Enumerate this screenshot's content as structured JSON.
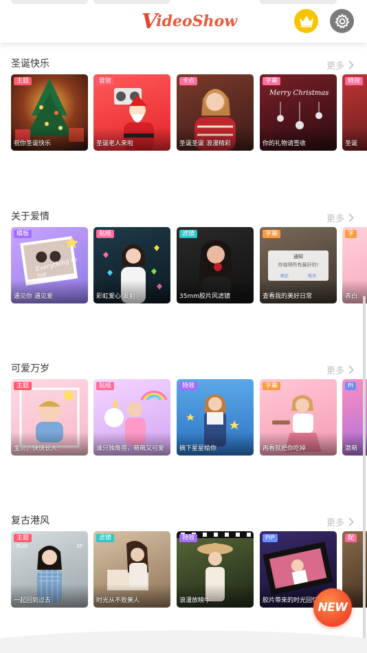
{
  "header": {
    "logo_text": "VideoShow",
    "logo_first": "V",
    "logo_rest": "ideoShow",
    "vip_icon": "crown-icon",
    "settings_icon": "gear-icon"
  },
  "more_label": "更多",
  "sections": [
    {
      "title": "圣诞快乐",
      "cards": [
        {
          "tag": "主题",
          "caption": "祝你圣诞快乐"
        },
        {
          "tag": "音效",
          "caption": "圣诞老人来啦"
        },
        {
          "tag": "卡点",
          "caption": "圣诞圣诞 浪漫精彩"
        },
        {
          "tag": "字幕",
          "caption": "你的礼物请签收"
        },
        {
          "tag": "特效",
          "caption": "圣诞"
        }
      ]
    },
    {
      "title": "关于爱情",
      "cards": [
        {
          "tag": "模板",
          "caption": "遇见你 遇见爱"
        },
        {
          "tag": "贴纸",
          "caption": "彩虹爱心 发射"
        },
        {
          "tag": "滤镜",
          "caption": "35mm胶片风滤镜"
        },
        {
          "tag": "字幕",
          "caption": "查看我的美好日常"
        },
        {
          "tag": "字",
          "caption": "表白"
        }
      ]
    },
    {
      "title": "可爱万岁",
      "cards": [
        {
          "tag": "主题",
          "caption": "宝贝，快快长大"
        },
        {
          "tag": "贴纸",
          "caption": "谁只独角兽，萌萌又可爱"
        },
        {
          "tag": "特效",
          "caption": "摘下星星给你"
        },
        {
          "tag": "字幕",
          "caption": "再看就把你吃掉"
        },
        {
          "tag": "PI",
          "caption": "激萌"
        }
      ]
    },
    {
      "title": "复古港风",
      "cards": [
        {
          "tag": "主题",
          "caption": "一起回到过去"
        },
        {
          "tag": "滤镜",
          "caption": "时光从不败美人"
        },
        {
          "tag": "特效",
          "caption": "浪漫放映中"
        },
        {
          "tag": "PIP",
          "caption": "胶片带来的时光回忆"
        },
        {
          "tag": "配",
          "caption": ""
        }
      ]
    }
  ],
  "overlay_texts": {
    "merry_christmas": "Merry Christmas",
    "everything_tome": "Everything to me",
    "notice_title": "通知",
    "notice_body": "你值得所有最好的!",
    "notice_ok": "确定",
    "notice_cancel": "取消",
    "vhs_play": "PLAY",
    "vhs_sp": "SP"
  },
  "new_badge": "NEW",
  "colors": {
    "accent": "#e85a3a",
    "vip": "#f6c400",
    "settings": "#7b7b7b",
    "more": "#c2c2c2"
  }
}
